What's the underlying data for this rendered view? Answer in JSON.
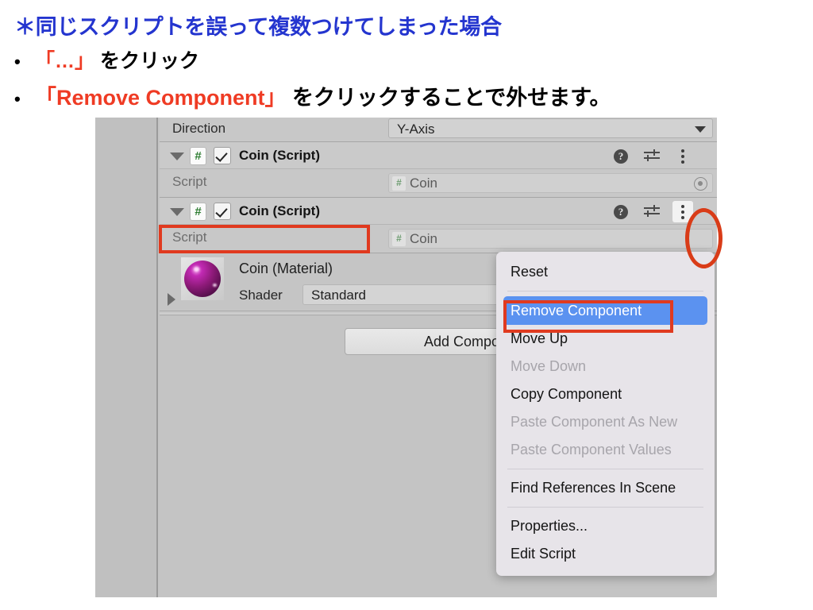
{
  "slide": {
    "headline": "＊同じスクリプトを誤って複数つけてしまった場合",
    "bullets": [
      {
        "marker": "•",
        "accent": "「…」",
        "rest": " をクリック"
      },
      {
        "marker": "•",
        "accent": "「Remove Component」",
        "rest": " をクリックすることで外せます。"
      }
    ],
    "colors": {
      "headline_blue": "#2435CF",
      "accent_red": "#EF3B24",
      "annotation_red": "#E03A1F",
      "menu_highlight_blue": "#5B92F0"
    }
  },
  "inspector": {
    "direction_row": {
      "label": "Direction",
      "value": "Y-Axis",
      "caret_icon": "chevron-down-icon"
    },
    "components": [
      {
        "title": "Coin (Script)",
        "foldout_icon": "triangle-down-icon",
        "type_icon": "#",
        "enabled": true,
        "help_icon": "?",
        "preset_icon": "sliders-icon",
        "menu_icon": "kebab-menu-icon",
        "script_label": "Script",
        "script_value": "Coin",
        "script_badge": "#",
        "picker_icon": "object-picker-icon"
      },
      {
        "title": "Coin (Script)",
        "foldout_icon": "triangle-down-icon",
        "type_icon": "#",
        "enabled": true,
        "help_icon": "?",
        "preset_icon": "sliders-icon",
        "menu_icon": "kebab-menu-icon",
        "script_label": "Script",
        "script_value": "Coin",
        "script_badge": "#",
        "picker_icon": "object-picker-icon"
      }
    ],
    "material": {
      "title": "Coin  (Material)",
      "foldout_icon": "triangle-right-icon",
      "preview_icon": "material-sphere-preview",
      "shader_label": "Shader",
      "shader_value": "Standard"
    },
    "add_component_label": "Add Component"
  },
  "context_menu": {
    "items": [
      {
        "label": "Reset",
        "state": "normal"
      },
      {
        "label": "Remove Component",
        "state": "selected"
      },
      {
        "label": "Move Up",
        "state": "normal"
      },
      {
        "label": "Move Down",
        "state": "disabled"
      },
      {
        "label": "Copy Component",
        "state": "normal"
      },
      {
        "label": "Paste Component As New",
        "state": "disabled"
      },
      {
        "label": "Paste Component Values",
        "state": "disabled"
      },
      {
        "label": "Find References In Scene",
        "state": "normal"
      },
      {
        "label": "Properties...",
        "state": "normal"
      },
      {
        "label": "Edit Script",
        "state": "normal"
      }
    ]
  }
}
